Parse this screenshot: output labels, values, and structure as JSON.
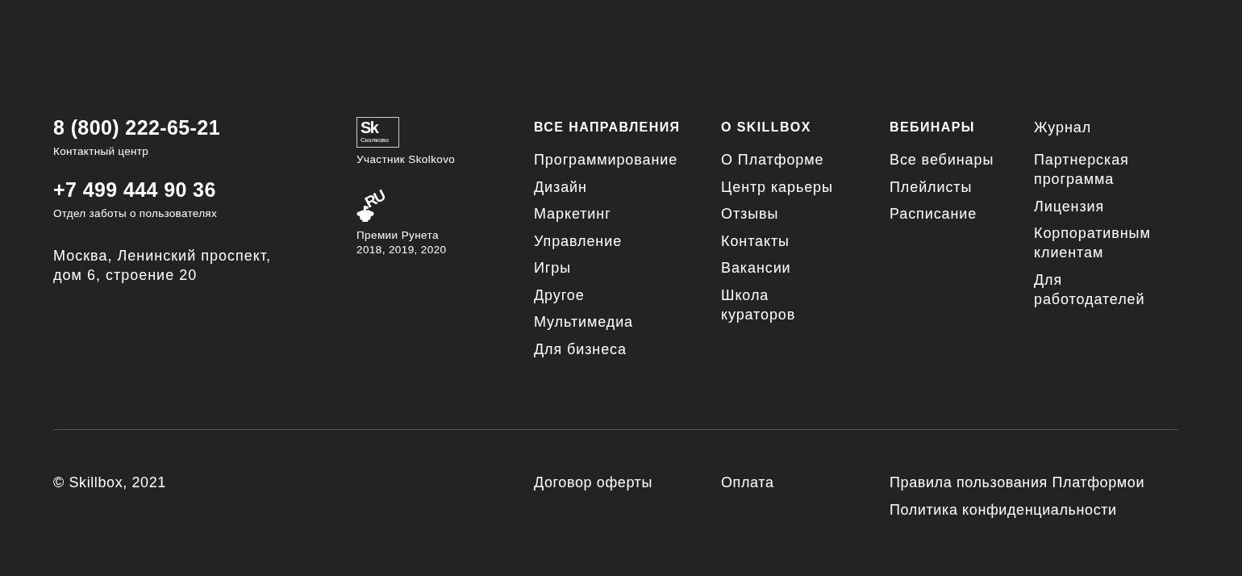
{
  "contacts": [
    {
      "phone": "8 (800) 222-65-21",
      "label": "Контактный центр"
    },
    {
      "phone": "+7 499 444 90 36",
      "label": "Отдел заботы о пользователях"
    }
  ],
  "address_lines": [
    "Москва, Ленинский проспект,",
    "дом 6, строение 20"
  ],
  "badges": [
    {
      "kind": "skolkovo",
      "logo_mark": "Sk",
      "logo_caption": "Сколково",
      "caption_lines": [
        "Участник Skolkovo"
      ]
    },
    {
      "kind": "runet",
      "logo_mark": ".RU",
      "caption_lines": [
        "Премии Рунета",
        "2018, 2019, 2020"
      ]
    }
  ],
  "nav_columns": [
    {
      "kind": "title",
      "heading": "ВСЕ НАПРАВЛЕНИЯ",
      "items": [
        "Программирование",
        "Дизайн",
        "Маркетинг",
        "Управление",
        "Игры",
        "Другое",
        "Мультимедиа",
        "Для бизнеса"
      ]
    },
    {
      "kind": "title",
      "heading": "О SKILLBOX",
      "items": [
        "О Платформе",
        "Центр карьеры",
        "Отзывы",
        "Контакты",
        "Вакансии",
        "Школа кураторов"
      ]
    },
    {
      "kind": "title",
      "heading": "ВЕБИНАРЫ",
      "items": [
        "Все вебинары",
        "Плейлисты",
        "Расписание"
      ]
    },
    {
      "kind": "link",
      "heading": "Журнал",
      "items": [
        "Партнерская программа",
        "Лицензия",
        "Корпоративным клиентам",
        "Для работодателей"
      ]
    }
  ],
  "copyright": "© Skillbox, 2021",
  "legal_groups": [
    {
      "links": [
        "Договор оферты"
      ]
    },
    {
      "links": [
        "Оплата"
      ]
    },
    {
      "links": [
        "Правила пользования Платформои",
        "Политика конфиденциальности"
      ]
    }
  ]
}
